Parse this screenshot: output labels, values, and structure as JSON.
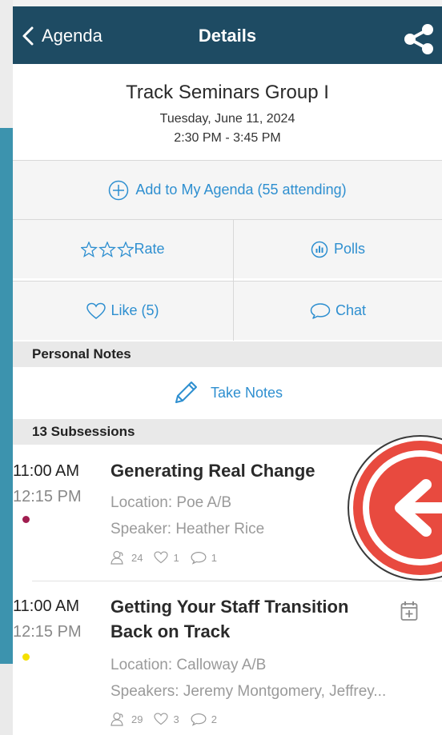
{
  "nav": {
    "back_label": "Agenda",
    "title": "Details"
  },
  "event": {
    "title": "Track Seminars Group I",
    "date": "Tuesday, June 11, 2024",
    "time": "2:30 PM - 3:45 PM"
  },
  "actions": {
    "add_to_agenda": "Add to My Agenda (55 attending)",
    "rate": "Rate",
    "polls": "Polls",
    "like": "Like (5)",
    "chat": "Chat"
  },
  "notes": {
    "header": "Personal Notes",
    "take_notes": "Take Notes"
  },
  "subsessions": {
    "header": "13 Subsessions",
    "items": [
      {
        "start": "11:00 AM",
        "end": "12:15 PM",
        "title_line1": "Generating Real Change",
        "title_line2": "",
        "location": "Location: Poe A/B",
        "speaker": "Speaker: Heather Rice",
        "attendees": "24",
        "likes": "1",
        "comments": "1",
        "dot_color": "#a01d4f"
      },
      {
        "start": "11:00 AM",
        "end": "12:15 PM",
        "title_line1": "Getting Your Staff Transition",
        "title_line2": "Back on Track",
        "location": "Location: Calloway A/B",
        "speaker": "Speakers: Jeremy Montgomery, Jeffrey...",
        "attendees": "29",
        "likes": "3",
        "comments": "2",
        "dot_color": "#f5e000"
      }
    ]
  },
  "colors": {
    "nav_bg": "#1e4b63",
    "accent": "#2e8fd0",
    "overlay": "#e84a3f"
  }
}
